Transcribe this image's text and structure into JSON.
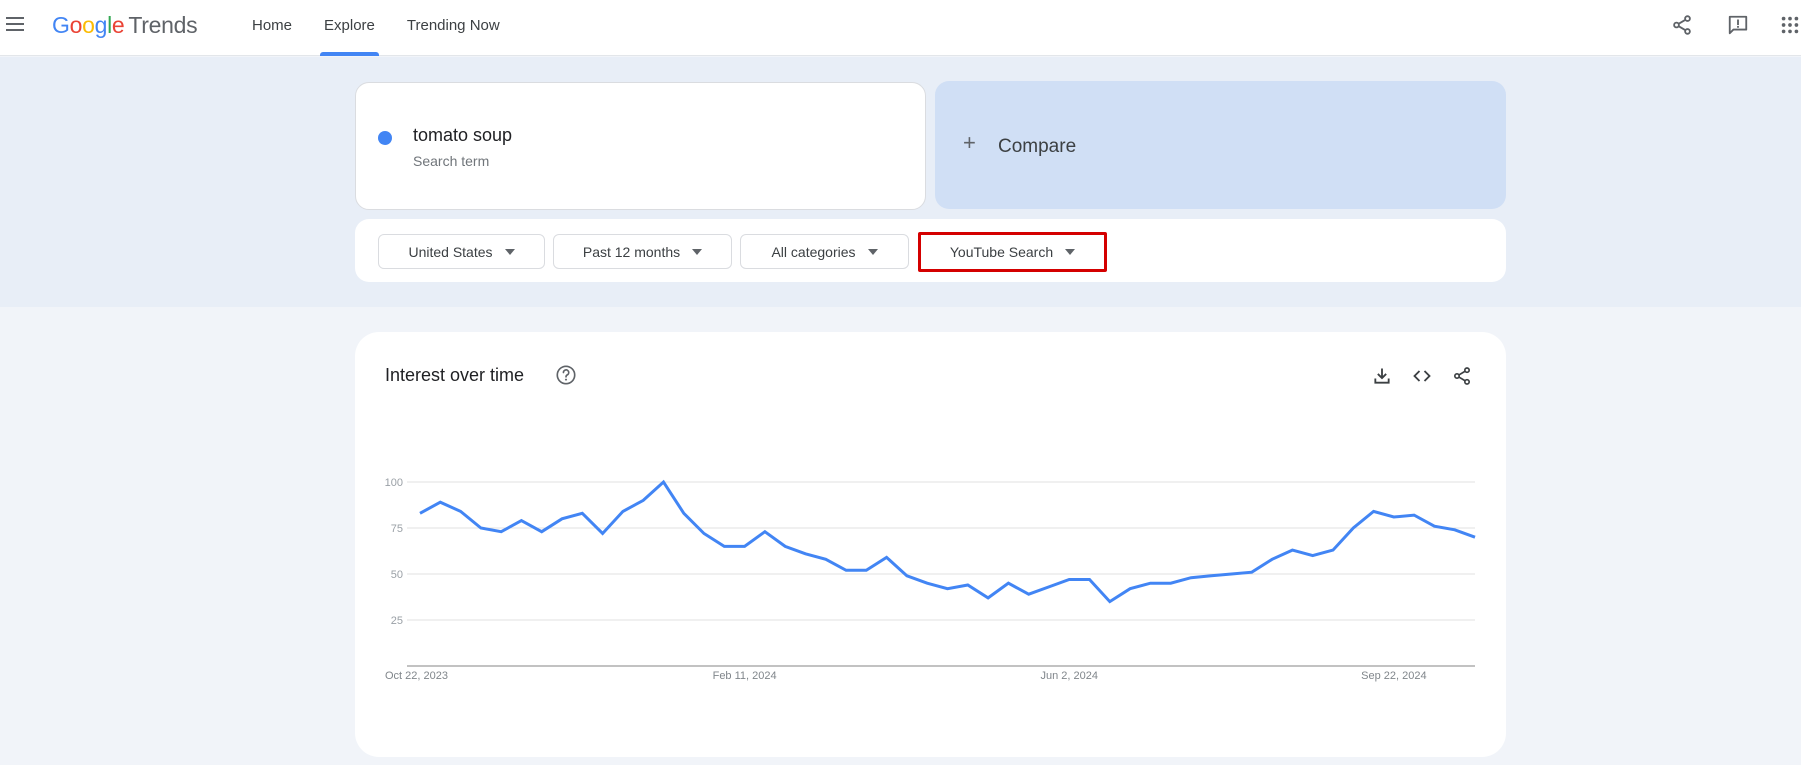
{
  "app": {
    "logo_letters": [
      "G",
      "o",
      "o",
      "g",
      "l",
      "e"
    ],
    "logo_suffix": "Trends"
  },
  "nav": {
    "items": [
      {
        "label": "Home",
        "active": false
      },
      {
        "label": "Explore",
        "active": true
      },
      {
        "label": "Trending Now",
        "active": false
      }
    ]
  },
  "top_icons": [
    "share-icon",
    "feedback-icon",
    "apps-grid-icon"
  ],
  "search_term": {
    "name": "tomato soup",
    "subtitle": "Search term",
    "color": "#4285f4"
  },
  "compare": {
    "label": "Compare",
    "icon": "plus-icon"
  },
  "filters": [
    {
      "label": "United States",
      "highlighted": false
    },
    {
      "label": "Past 12 months",
      "highlighted": false
    },
    {
      "label": "All categories",
      "highlighted": false
    },
    {
      "label": "YouTube Search",
      "highlighted": true
    }
  ],
  "highlight_color": "#d40000",
  "chart_card": {
    "title": "Interest over time",
    "actions": [
      "download-icon",
      "embed-icon",
      "share-icon"
    ]
  },
  "chart_data": {
    "type": "line",
    "title": "Interest over time",
    "xlabel": "",
    "ylabel": "",
    "ylim": [
      0,
      100
    ],
    "yticks": [
      25,
      50,
      75,
      100
    ],
    "grid": true,
    "x_tick_labels": [
      {
        "label": "Oct 22, 2023",
        "index": 0
      },
      {
        "label": "Feb 11, 2024",
        "index": 16
      },
      {
        "label": "Jun 2, 2024",
        "index": 32
      },
      {
        "label": "Sep 22, 2024",
        "index": 48
      }
    ],
    "series": [
      {
        "name": "tomato soup",
        "color": "#4285f4",
        "values": [
          83,
          89,
          84,
          75,
          73,
          79,
          73,
          80,
          83,
          72,
          84,
          90,
          100,
          83,
          72,
          65,
          65,
          73,
          65,
          61,
          58,
          52,
          52,
          59,
          49,
          45,
          42,
          44,
          37,
          45,
          39,
          43,
          47,
          47,
          35,
          42,
          45,
          45,
          48,
          49,
          50,
          51,
          58,
          63,
          60,
          63,
          75,
          84,
          81,
          82,
          76,
          74,
          70
        ]
      }
    ]
  }
}
